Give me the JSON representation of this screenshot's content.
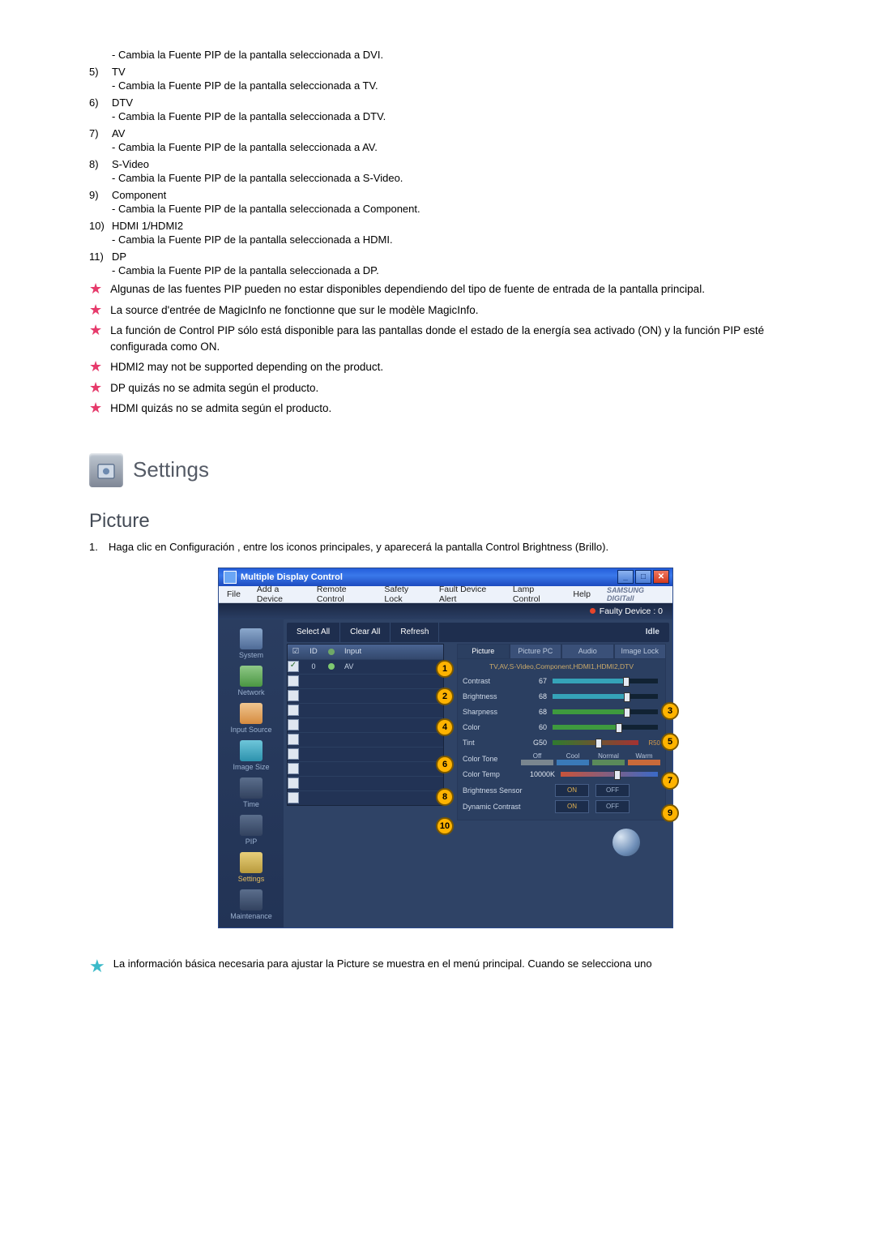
{
  "preList": {
    "dviDesc": "- Cambia la Fuente PIP de la pantalla seleccionada a DVI."
  },
  "list": [
    {
      "num": "5)",
      "title": "TV",
      "desc": "- Cambia la Fuente PIP de la pantalla seleccionada a TV."
    },
    {
      "num": "6)",
      "title": "DTV",
      "desc": "- Cambia la Fuente PIP de la pantalla seleccionada a DTV."
    },
    {
      "num": "7)",
      "title": "AV",
      "desc": "- Cambia la Fuente PIP de la pantalla seleccionada a AV."
    },
    {
      "num": "8)",
      "title": "S-Video",
      "desc": "- Cambia la Fuente PIP de la pantalla seleccionada a S-Video."
    },
    {
      "num": "9)",
      "title": "Component",
      "desc": "- Cambia la Fuente PIP de la pantalla seleccionada a Component."
    },
    {
      "num": "10)",
      "title": "HDMI 1/HDMI2",
      "desc": "- Cambia la Fuente PIP de la pantalla seleccionada a HDMI."
    },
    {
      "num": "11)",
      "title": "DP",
      "desc": "- Cambia la Fuente PIP de la pantalla seleccionada a DP."
    }
  ],
  "notes": [
    "Algunas de las fuentes PIP pueden no estar disponibles dependiendo del tipo de fuente de entrada de la pantalla principal.",
    "La source d'entrée de MagicInfo ne fonctionne que sur le modèle MagicInfo.",
    "La función de Control PIP sólo está disponible para las pantallas donde el estado de la energía sea activado (ON) y la función PIP esté configurada como ON.",
    "HDMI2 may not be supported depending on the product.",
    "DP quizás no se admita según el producto.",
    "HDMI quizás no se admita según el producto."
  ],
  "section": {
    "title": "Settings"
  },
  "subsection": {
    "title": "Picture"
  },
  "step": {
    "num": "1.",
    "text": "Haga clic en Configuración , entre los iconos principales, y aparecerá la pantalla Control Brightness (Brillo)."
  },
  "app": {
    "title": "Multiple Display Control",
    "menu": [
      "File",
      "Add a Device",
      "Remote Control",
      "Safety Lock",
      "Fault Device Alert",
      "Lamp Control",
      "Help"
    ],
    "brand": "SAMSUNG DIGITall",
    "faulty": "Faulty Device : 0",
    "buttons": {
      "selectAll": "Select All",
      "clearAll": "Clear All",
      "refresh": "Refresh"
    },
    "status": "Idle",
    "sidebar": [
      {
        "label": "System",
        "cls": "",
        "key": "system"
      },
      {
        "label": "Network",
        "cls": "green",
        "key": "network"
      },
      {
        "label": "Input Source",
        "cls": "orange",
        "key": "input-source"
      },
      {
        "label": "Image Size",
        "cls": "teal",
        "key": "image-size"
      },
      {
        "label": "Time",
        "cls": "dark",
        "key": "time"
      },
      {
        "label": "PIP",
        "cls": "dark",
        "key": "pip"
      },
      {
        "label": "Settings",
        "cls": "yellow",
        "key": "settings",
        "selected": true
      },
      {
        "label": "Maintenance",
        "cls": "dark",
        "key": "maintenance"
      }
    ],
    "deviceHeader": {
      "cb": "☑",
      "id": "ID",
      "st": "",
      "input": "Input"
    },
    "deviceRows": [
      {
        "checked": true,
        "id": "0",
        "input": "AV"
      },
      {
        "checked": false,
        "id": "",
        "input": ""
      },
      {
        "checked": false,
        "id": "",
        "input": ""
      },
      {
        "checked": false,
        "id": "",
        "input": ""
      },
      {
        "checked": false,
        "id": "",
        "input": ""
      },
      {
        "checked": false,
        "id": "",
        "input": ""
      },
      {
        "checked": false,
        "id": "",
        "input": ""
      },
      {
        "checked": false,
        "id": "",
        "input": ""
      },
      {
        "checked": false,
        "id": "",
        "input": ""
      },
      {
        "checked": false,
        "id": "",
        "input": ""
      }
    ],
    "tabs": [
      "Picture",
      "Picture PC",
      "Audio",
      "Image Lock"
    ],
    "panelSub": "TV,AV,S-Video,Component,HDMI1,HDMI2,DTV",
    "sliders": {
      "contrast": {
        "label": "Contrast",
        "value": "67",
        "pct": 67,
        "color": "#35a3b8"
      },
      "brightness": {
        "label": "Brightness",
        "value": "68",
        "pct": 68,
        "color": "#35a3b8"
      },
      "sharpness": {
        "label": "Sharpness",
        "value": "68",
        "pct": 68,
        "color": "#3e9a3e"
      },
      "color": {
        "label": "Color",
        "value": "60",
        "pct": 60,
        "color": "#3e9a3e"
      },
      "tint": {
        "label": "Tint",
        "valueL": "G50",
        "valueR": "R50",
        "pct": 50
      },
      "colorTemp": {
        "label": "Color Temp",
        "value": "10000K",
        "pct": 55
      }
    },
    "colorTone": {
      "label": "Color Tone",
      "options": [
        "Off",
        "Cool",
        "Normal",
        "Warm"
      ]
    },
    "brightnessSensor": {
      "label": "Brightness Sensor",
      "on": "ON",
      "off": "OFF"
    },
    "dynamicContrast": {
      "label": "Dynamic Contrast",
      "on": "ON",
      "off": "OFF"
    }
  },
  "footer": "La información básica necesaria para ajustar la Picture se muestra en el menú principal. Cuando se selecciona uno"
}
